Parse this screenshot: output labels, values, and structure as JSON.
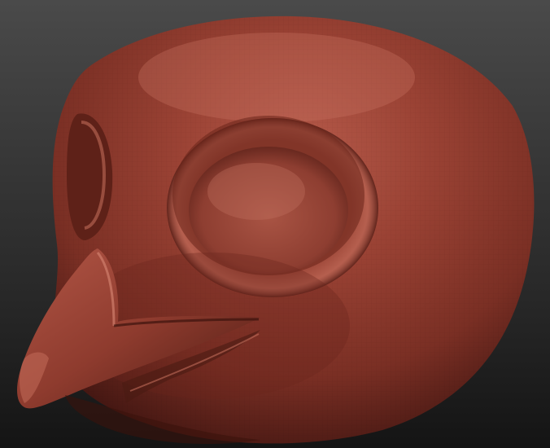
{
  "scene": {
    "subject": "sculpted-bird-head",
    "background_top": "#4a4a4a",
    "background_bottom": "#141414",
    "material_base": "#8a3a2e",
    "material_highlight": "#c46a5a",
    "material_shadow": "#3e1410"
  }
}
